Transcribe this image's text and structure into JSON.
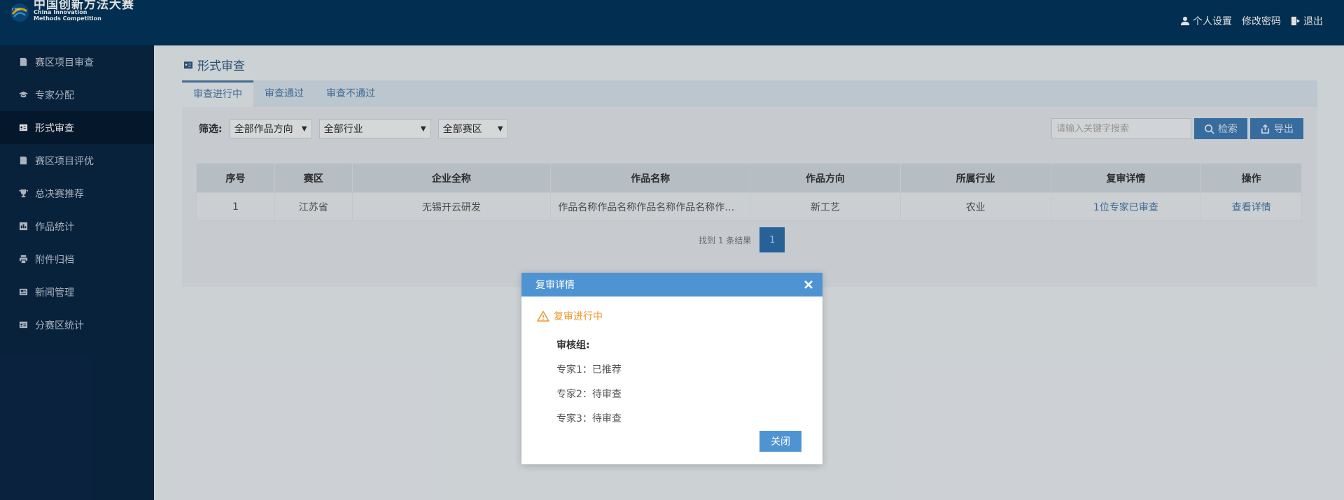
{
  "header": {
    "logo": {
      "cn": "中国创新方法大赛",
      "en_line1": "China Innovation",
      "en_line2": "Methods Competition",
      "badge": "CIMC"
    },
    "nav": [
      {
        "label": "个人设置",
        "icon": "user-icon"
      },
      {
        "label": "修改密码",
        "icon": "none"
      },
      {
        "label": "退出",
        "icon": "logout-icon"
      }
    ]
  },
  "sidebar": {
    "items": [
      {
        "label": "赛区项目审查",
        "icon": "document-icon",
        "active": false
      },
      {
        "label": "专家分配",
        "icon": "graduation-cap-icon",
        "active": false
      },
      {
        "label": "形式审查",
        "icon": "id-card-icon",
        "active": true
      },
      {
        "label": "赛区项目评优",
        "icon": "document-icon",
        "active": false
      },
      {
        "label": "总决赛推荐",
        "icon": "trophy-icon",
        "active": false
      },
      {
        "label": "作品统计",
        "icon": "bar-chart-icon",
        "active": false
      },
      {
        "label": "附件归档",
        "icon": "printer-icon",
        "active": false
      },
      {
        "label": "新闻管理",
        "icon": "newspaper-icon",
        "active": false
      },
      {
        "label": "分赛区统计",
        "icon": "id-card-icon",
        "active": false
      }
    ]
  },
  "main": {
    "title": "形式审查",
    "tabs": [
      {
        "label": "审查进行中",
        "active": true
      },
      {
        "label": "审查通过",
        "active": false
      },
      {
        "label": "审查不通过",
        "active": false
      }
    ],
    "filter": {
      "label": "筛选:",
      "selects": [
        "全部作品方向",
        "全部行业",
        "全部赛区"
      ]
    },
    "search": {
      "placeholder": "请输入关键字搜索",
      "search_label": "检索",
      "export_label": "导出"
    },
    "table": {
      "headers": [
        "序号",
        "赛区",
        "企业全称",
        "作品名称",
        "作品方向",
        "所属行业",
        "复审详情",
        "操作"
      ],
      "rows": [
        {
          "no": "1",
          "region": "江苏省",
          "company": "无锡开云研发",
          "work": "作品名称作品名称作品名称作品名称作品名称",
          "direction": "新工艺",
          "industry": "农业",
          "review": "1位专家已审查",
          "action": "查看详情"
        }
      ]
    },
    "pager": {
      "summary": "找到 1 条结果",
      "current": "1"
    }
  },
  "modal": {
    "title": "复审详情",
    "status": "复审进行中",
    "group_title": "审核组:",
    "experts": [
      "专家1：已推荐",
      "专家2：待审查",
      "专家3：待审查"
    ],
    "close_label": "关闭"
  },
  "colors": {
    "header_bg": "#03365d",
    "sidebar_bg": "#0b2745",
    "accent": "#4f94d2",
    "warning": "#f0962a",
    "link": "#4a7aa8"
  }
}
